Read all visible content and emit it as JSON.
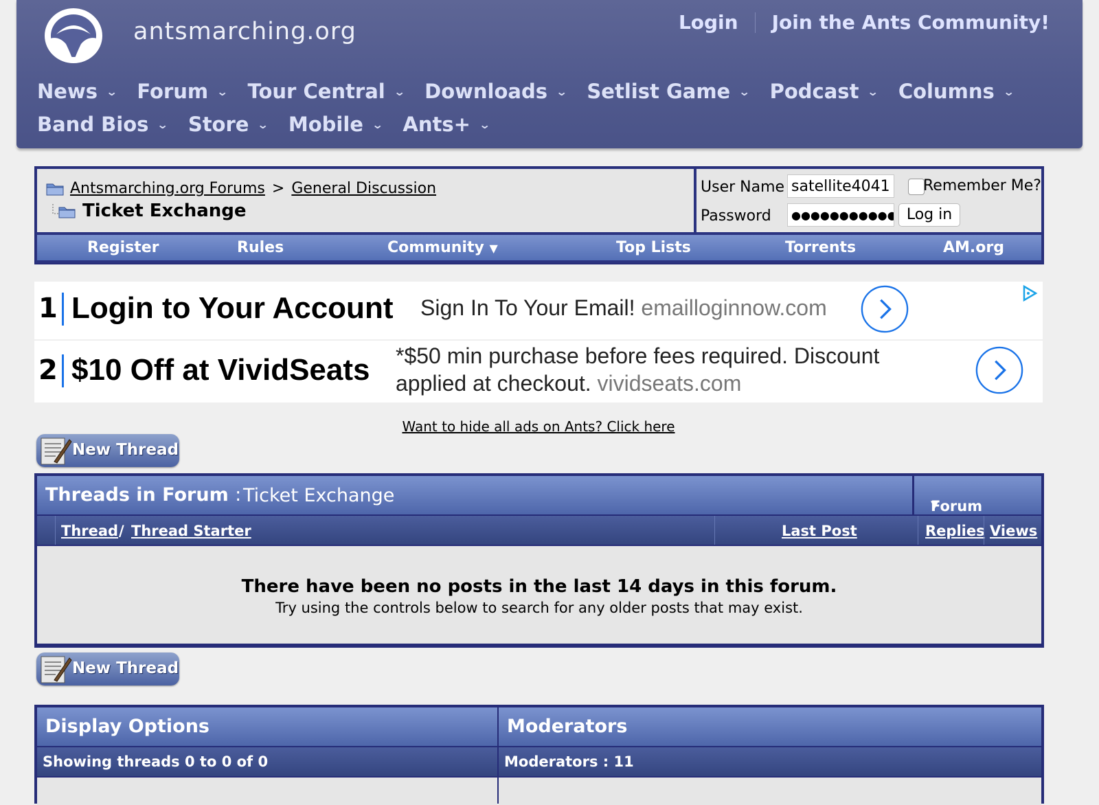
{
  "header": {
    "site_name": "antsmarching.org",
    "login": "Login",
    "join": "Join the Ants Community!",
    "nav": [
      "News",
      "Forum",
      "Tour Central",
      "Downloads",
      "Setlist Game",
      "Podcast",
      "Columns",
      "Band Bios",
      "Store",
      "Mobile",
      "Ants+"
    ]
  },
  "breadcrumb": {
    "root": "Antsmarching.org Forums",
    "sep": ">",
    "parent": "General Discussion",
    "current": "Ticket Exchange"
  },
  "login_form": {
    "username_label": "User Name",
    "username_value": "satellite4041",
    "password_label": "Password",
    "password_value": "●●●●●●●●●●●●●",
    "remember_label": "Remember Me?",
    "button": "Log in"
  },
  "subnav": [
    "Register",
    "Rules",
    "Community",
    "Top Lists",
    "Torrents",
    "AM.org"
  ],
  "ads": [
    {
      "num": "1",
      "title": "Login to Your Account",
      "desc": "Sign In To Your Email!",
      "domain": "emailloginnow.com"
    },
    {
      "num": "2",
      "title": "$10 Off at VividSeats",
      "desc_line1": "*$50 min purchase before fees required. Discount",
      "desc_line2": "applied at checkout.",
      "domain": "vividseats.com"
    }
  ],
  "hide_ads": "Want to hide all ads on Ants? Click here",
  "new_thread": "New Thread",
  "threads": {
    "title": "Threads in Forum",
    "colon": ":",
    "forum": "Ticket Exchange",
    "tools": "Forum Tools",
    "col_thread": "Thread",
    "col_slash": "/",
    "col_starter": "Thread Starter",
    "col_last": "Last Post",
    "col_replies": "Replies",
    "col_views": "Views",
    "empty_title": "There have been no posts in the last 14 days in this forum.",
    "empty_hint": "Try using the controls below to search for any older posts that may exist."
  },
  "display_options": {
    "title": "Display Options",
    "showing": "Showing threads 0 to 0 of 0"
  },
  "moderators": {
    "title": "Moderators",
    "count": "Moderators : 11"
  },
  "colors": {
    "header_bg": "#515a8e",
    "table_border": "#262c78",
    "table_head": "#6a82c2",
    "ad_accent": "#1a73e8"
  }
}
